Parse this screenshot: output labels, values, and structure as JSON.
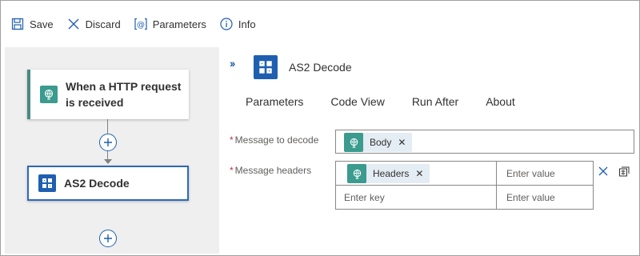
{
  "toolbar": {
    "save_label": "Save",
    "discard_label": "Discard",
    "parameters_label": "Parameters",
    "info_label": "Info"
  },
  "canvas": {
    "trigger": {
      "title": "When a HTTP request is received",
      "icon": "http-request-icon"
    },
    "action": {
      "title": "AS2 Decode",
      "icon": "as2-icon"
    }
  },
  "details": {
    "title": "AS2 Decode",
    "tabs": [
      {
        "label": "Parameters",
        "active": true
      },
      {
        "label": "Code View"
      },
      {
        "label": "Run After"
      },
      {
        "label": "About"
      }
    ],
    "fields": {
      "message_to_decode": {
        "label": "Message to decode",
        "required_mark": "*",
        "token": "Body"
      },
      "message_headers": {
        "label": "Message headers",
        "required_mark": "*",
        "rows": [
          {
            "key_token": "Headers",
            "value_placeholder": "Enter value"
          },
          {
            "key_placeholder": "Enter key",
            "value_placeholder": "Enter value"
          }
        ]
      }
    }
  },
  "colors": {
    "accent": "#1f5fb0",
    "trigger_accent": "#3a9b8e",
    "required": "#c4314b",
    "canvas_bg": "#efefef"
  }
}
